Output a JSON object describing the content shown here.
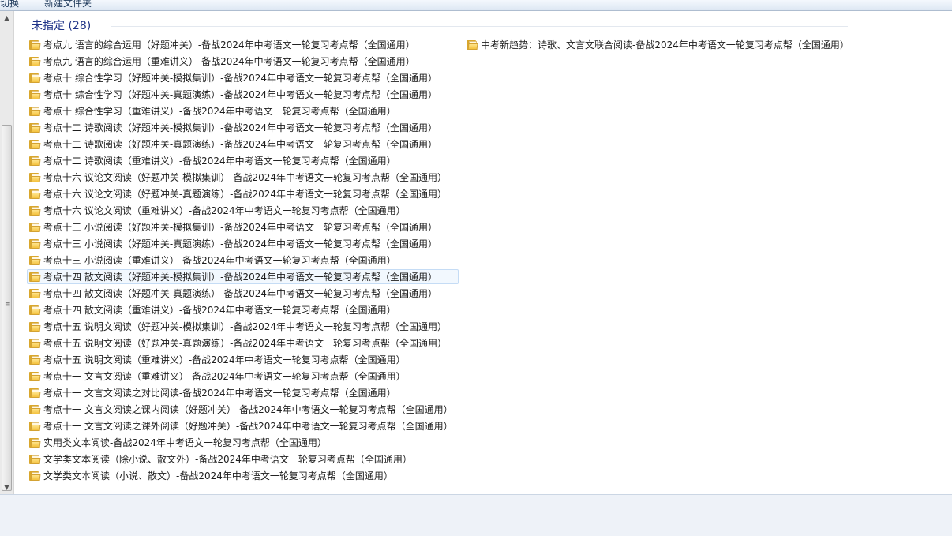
{
  "toolbar": {
    "left_label": "切换",
    "new_folder_label": "新建文件夹"
  },
  "group": {
    "title": "未指定 (28)"
  },
  "column1": [
    "考点九 语言的综合运用（好题冲关）-备战2024年中考语文一轮复习考点帮（全国通用）",
    "考点九 语言的综合运用（重难讲义）-备战2024年中考语文一轮复习考点帮（全国通用）",
    "考点十 综合性学习（好题冲关-模拟集训）-备战2024年中考语文一轮复习考点帮（全国通用）",
    "考点十 综合性学习（好题冲关-真题演练）-备战2024年中考语文一轮复习考点帮（全国通用）",
    "考点十 综合性学习（重难讲义）-备战2024年中考语文一轮复习考点帮（全国通用）",
    "考点十二 诗歌阅读（好题冲关-模拟集训）-备战2024年中考语文一轮复习考点帮（全国通用）",
    "考点十二 诗歌阅读（好题冲关-真题演练）-备战2024年中考语文一轮复习考点帮（全国通用）",
    "考点十二 诗歌阅读（重难讲义）-备战2024年中考语文一轮复习考点帮（全国通用）",
    "考点十六 议论文阅读（好题冲关-模拟集训）-备战2024年中考语文一轮复习考点帮（全国通用）",
    "考点十六 议论文阅读（好题冲关-真题演练）-备战2024年中考语文一轮复习考点帮（全国通用）",
    "考点十六 议论文阅读（重难讲义）-备战2024年中考语文一轮复习考点帮（全国通用）",
    "考点十三 小说阅读（好题冲关-模拟集训）-备战2024年中考语文一轮复习考点帮（全国通用）",
    "考点十三 小说阅读（好题冲关-真题演练）-备战2024年中考语文一轮复习考点帮（全国通用）",
    "考点十三 小说阅读（重难讲义）-备战2024年中考语文一轮复习考点帮（全国通用）",
    "考点十四 散文阅读（好题冲关-模拟集训）-备战2024年中考语文一轮复习考点帮（全国通用）",
    "考点十四 散文阅读（好题冲关-真题演练）-备战2024年中考语文一轮复习考点帮（全国通用）",
    "考点十四 散文阅读（重难讲义）-备战2024年中考语文一轮复习考点帮（全国通用）",
    "考点十五 说明文阅读（好题冲关-模拟集训）-备战2024年中考语文一轮复习考点帮（全国通用）",
    "考点十五 说明文阅读（好题冲关-真题演练）-备战2024年中考语文一轮复习考点帮（全国通用）",
    "考点十五 说明文阅读（重难讲义）-备战2024年中考语文一轮复习考点帮（全国通用）",
    "考点十一 文言文阅读（重难讲义）-备战2024年中考语文一轮复习考点帮（全国通用）",
    "考点十一 文言文阅读之对比阅读-备战2024年中考语文一轮复习考点帮（全国通用）",
    "考点十一 文言文阅读之课内阅读（好题冲关）-备战2024年中考语文一轮复习考点帮（全国通用）",
    "考点十一 文言文阅读之课外阅读（好题冲关）-备战2024年中考语文一轮复习考点帮（全国通用）",
    "实用类文本阅读-备战2024年中考语文一轮复习考点帮（全国通用）",
    "文学类文本阅读（除小说、散文外）-备战2024年中考语文一轮复习考点帮（全国通用）",
    "文学类文本阅读（小说、散文）-备战2024年中考语文一轮复习考点帮（全国通用）"
  ],
  "column2": [
    "中考新趋势：诗歌、文言文联合阅读-备战2024年中考语文一轮复习考点帮（全国通用）"
  ],
  "hovered_index": 14,
  "colors": {
    "group_header": "#1e3287",
    "folder": "#f4c23e",
    "hover_border": "#c5dcf5"
  }
}
